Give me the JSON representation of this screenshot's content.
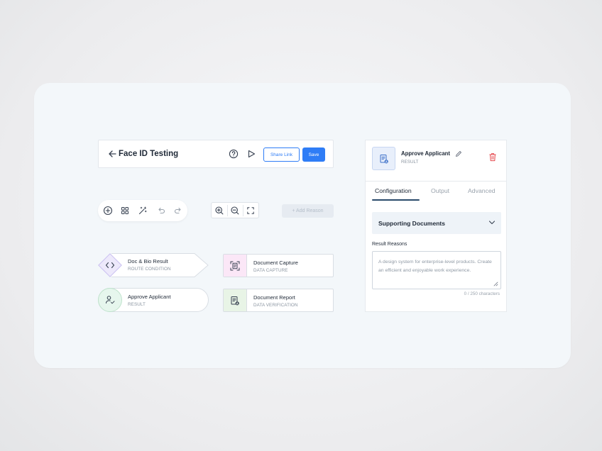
{
  "topbar": {
    "title": "Face ID Testing",
    "share_label": "Share Link",
    "save_label": "Save"
  },
  "toolbar": {
    "add_reason_label": "+ Add Reason"
  },
  "nodes": [
    {
      "title": "Doc & Bio Result",
      "subtitle": "ROUTE CONDITION",
      "icon": "code-icon",
      "color": "#ede9fb"
    },
    {
      "title": "Document Capture",
      "subtitle": "DATA CAPTURE",
      "icon": "scan-icon",
      "color": "#fbe7f7"
    },
    {
      "title": "Approve Applicant",
      "subtitle": "RESULT",
      "icon": "user-check-icon",
      "color": "#e6f6ed"
    },
    {
      "title": "Document Report",
      "subtitle": "DATA VERIFICATION",
      "icon": "document-report-icon",
      "color": "#e8f4e6"
    }
  ],
  "panel": {
    "title": "Approve Applicant",
    "subtitle": "RESULT",
    "tabs": [
      {
        "label": "Configuration",
        "active": true
      },
      {
        "label": "Output",
        "active": false
      },
      {
        "label": "Advanced",
        "active": false
      }
    ],
    "accordion_label": "Supporting Documents",
    "field_label": "Result Reasons",
    "textarea_value": "A design system for enterprise-level products. Create an efficient and enjoyable work experience.",
    "counter": "0 / 250 characters"
  },
  "colors": {
    "accent": "#2f7df6",
    "danger": "#e5484d",
    "tab_underline": "#2a4a6b"
  }
}
